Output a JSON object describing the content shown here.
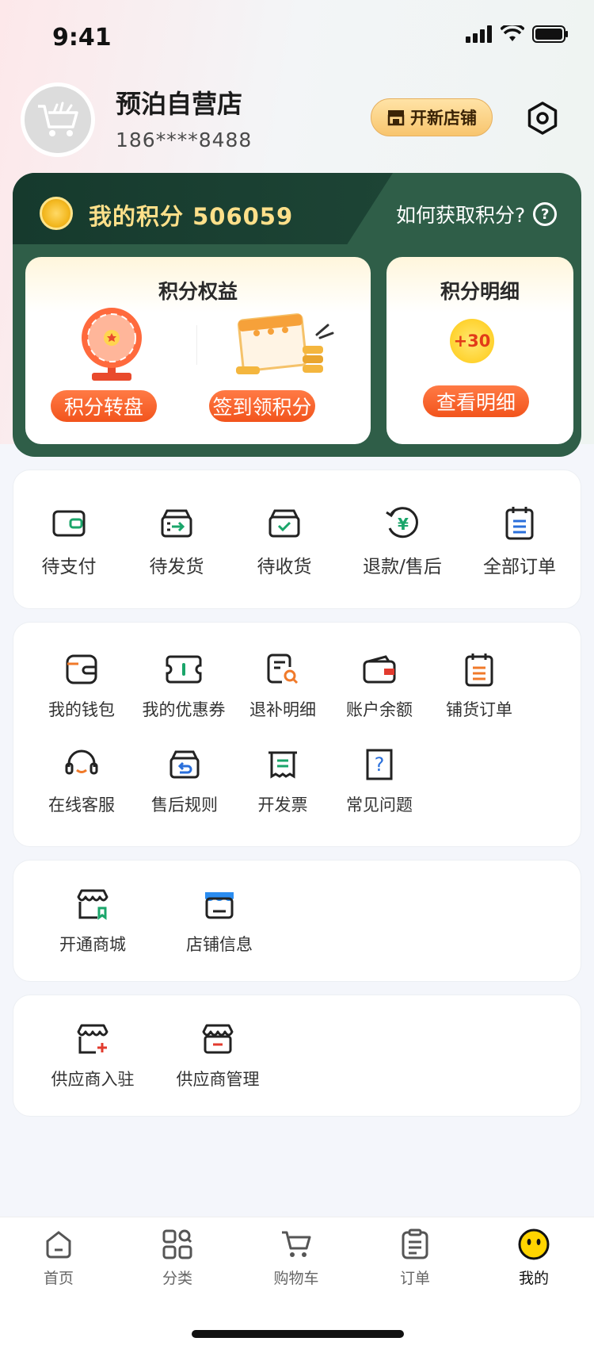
{
  "status_bar": {
    "time": "9:41"
  },
  "profile": {
    "shop_name": "预泊自营店",
    "phone": "186****8488",
    "open_shop_label": "开新店铺"
  },
  "points": {
    "title": "我的积分 506059",
    "how_to_get": "如何获取积分?",
    "benefits": {
      "title": "积分权益",
      "wheel_label": "积分转盘",
      "signin_label": "签到领积分"
    },
    "detail": {
      "title": "积分明细",
      "badge": "+30",
      "view_label": "查看明细"
    }
  },
  "orders": [
    {
      "label": "待支付",
      "icon": "wallet-icon"
    },
    {
      "label": "待发货",
      "icon": "ship-box-icon"
    },
    {
      "label": "待收货",
      "icon": "receive-box-icon"
    },
    {
      "label": "退款/售后",
      "icon": "refund-icon"
    },
    {
      "label": "全部订单",
      "icon": "clipboard-icon"
    }
  ],
  "services": [
    {
      "label": "我的钱包",
      "icon": "wallet-icon"
    },
    {
      "label": "我的优惠券",
      "icon": "coupon-icon"
    },
    {
      "label": "退补明细",
      "icon": "search-doc-icon"
    },
    {
      "label": "账户余额",
      "icon": "balance-wallet-icon"
    },
    {
      "label": "铺货订单",
      "icon": "order-list-icon"
    },
    {
      "label": "在线客服",
      "icon": "headset-icon"
    },
    {
      "label": "售后规则",
      "icon": "return-box-icon"
    },
    {
      "label": "开发票",
      "icon": "invoice-icon"
    },
    {
      "label": "常见问题",
      "icon": "question-doc-icon"
    }
  ],
  "store": [
    {
      "label": "开通商城",
      "icon": "mall-store-icon"
    },
    {
      "label": "店铺信息",
      "icon": "store-info-icon"
    }
  ],
  "supplier": [
    {
      "label": "供应商入驻",
      "icon": "store-add-icon"
    },
    {
      "label": "供应商管理",
      "icon": "store-manage-icon"
    }
  ],
  "tabbar": [
    {
      "label": "首页",
      "icon": "home-icon"
    },
    {
      "label": "分类",
      "icon": "category-icon"
    },
    {
      "label": "购物车",
      "icon": "cart-icon"
    },
    {
      "label": "订单",
      "icon": "order-icon"
    },
    {
      "label": "我的",
      "icon": "smiley-icon"
    }
  ],
  "colors": {
    "accent_orange": "#f2541c",
    "points_green": "#2f5e48",
    "points_gold": "#ffe08a"
  }
}
